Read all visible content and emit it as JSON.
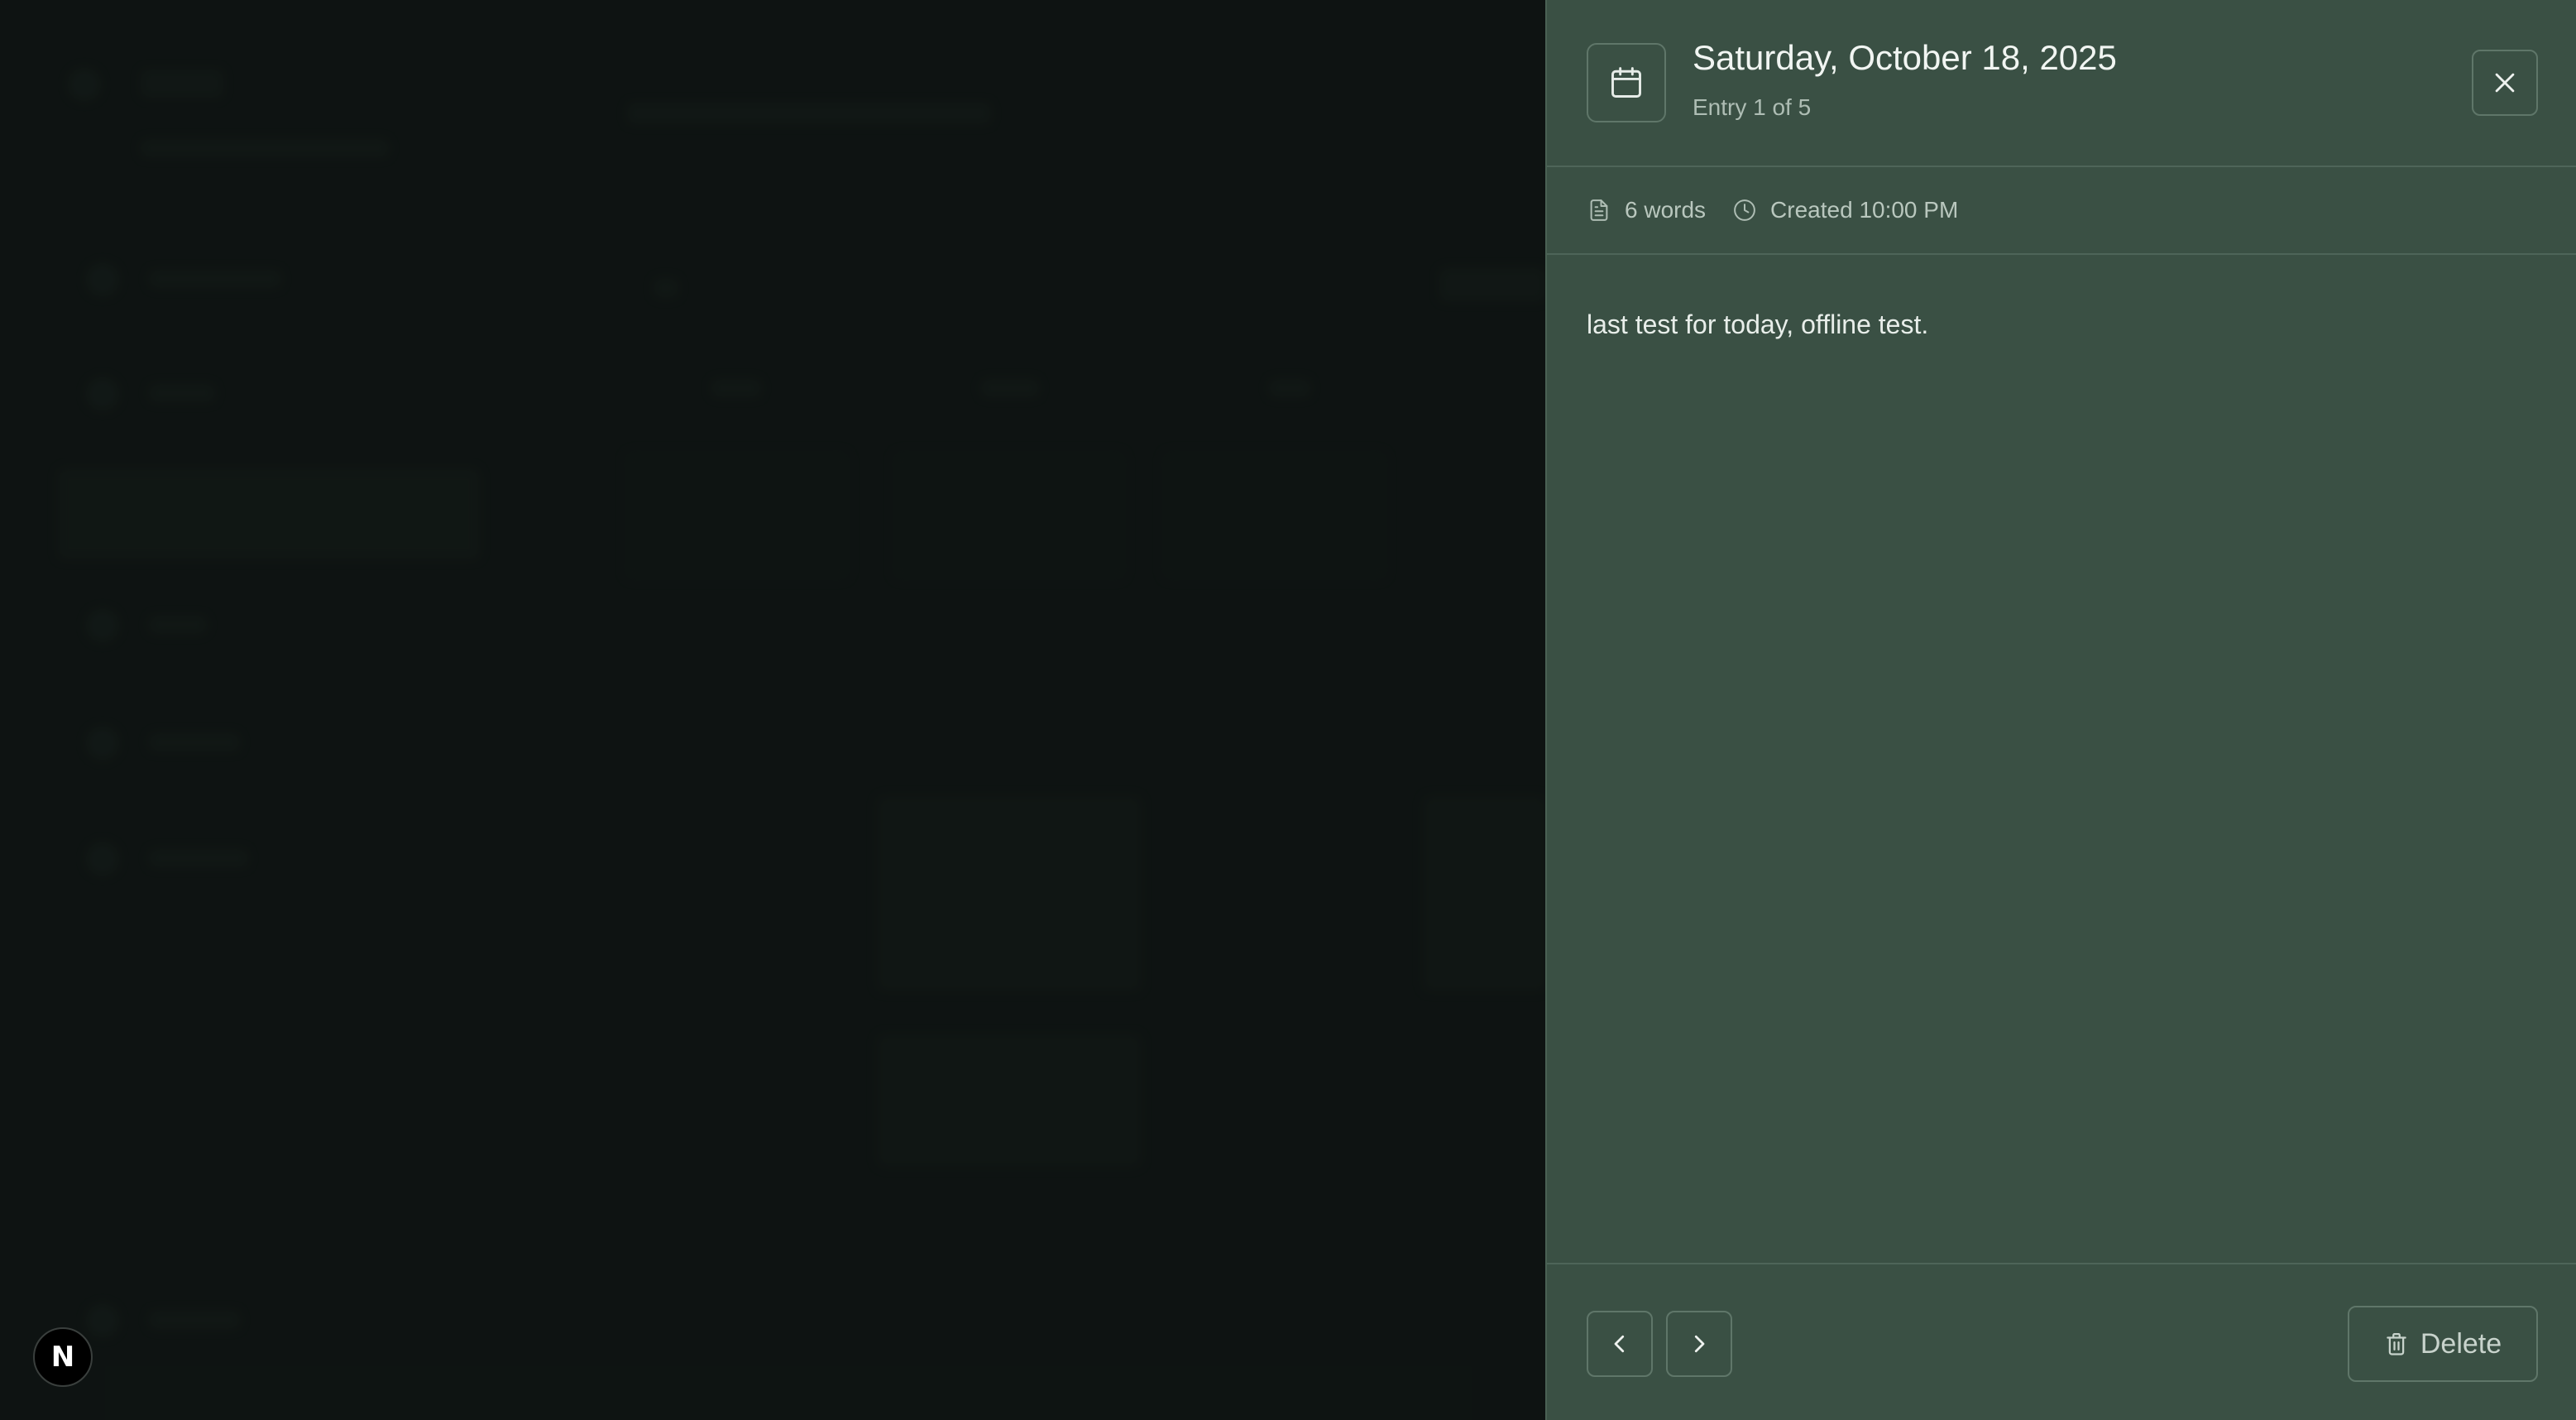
{
  "entry": {
    "date_title": "Saturday, October 18, 2025",
    "position": "Entry 1 of 5",
    "word_count": "6 words",
    "created": "Created 10:00 PM",
    "body": "last test for today, offline test."
  },
  "footer": {
    "delete_label": "Delete"
  },
  "dev_badge": {
    "letter": "N"
  },
  "icons": {
    "calendar": "calendar-icon",
    "close": "close-icon",
    "document": "document-icon",
    "clock": "clock-icon",
    "chevron_left": "chevron-left-icon",
    "chevron_right": "chevron-right-icon",
    "trash": "trash-icon"
  },
  "colors": {
    "panel_bg": "#3a5044",
    "backdrop_bg": "#131b18",
    "text_primary": "#f1f5f2",
    "text_muted": "#aebdb4"
  }
}
